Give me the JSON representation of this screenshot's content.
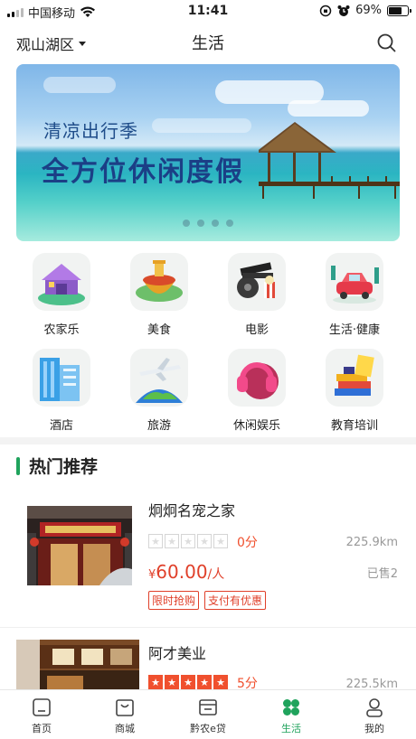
{
  "status_bar": {
    "carrier": "中国移动",
    "time": "11:41",
    "battery": "69%",
    "battery_level": 0.69
  },
  "nav": {
    "location": "观山湖区",
    "title": "生活"
  },
  "banner": {
    "subtitle": "清凉出行季",
    "headline": "全方位休闲度假",
    "slide_count": 4
  },
  "categories": [
    {
      "label": "农家乐",
      "icon": "farmhouse-icon"
    },
    {
      "label": "美食",
      "icon": "hotpot-icon"
    },
    {
      "label": "电影",
      "icon": "movie-icon"
    },
    {
      "label": "生活·健康",
      "icon": "car-wash-icon"
    },
    {
      "label": "酒店",
      "icon": "hotel-icon"
    },
    {
      "label": "旅游",
      "icon": "airplane-icon"
    },
    {
      "label": "休闲娱乐",
      "icon": "headphones-icon"
    },
    {
      "label": "教育培训",
      "icon": "books-icon"
    }
  ],
  "hot": {
    "title": "热门推荐",
    "items": [
      {
        "name": "炯炯名宠之家",
        "rating": 0,
        "score": "0分",
        "distance": "225.9km",
        "price_symbol": "¥",
        "price": "60.00",
        "price_unit": "/人",
        "sold": "已售2",
        "tags": [
          "限时抢购",
          "支付有优惠"
        ]
      },
      {
        "name": "阿才美业",
        "rating": 5,
        "score": "5分",
        "distance": "225.5km"
      }
    ]
  },
  "tabs": [
    {
      "label": "首页",
      "icon": "home-icon",
      "active": false
    },
    {
      "label": "商城",
      "icon": "shopping-bag-icon",
      "active": false
    },
    {
      "label": "黔农e贷",
      "icon": "wallet-icon",
      "active": false
    },
    {
      "label": "生活",
      "icon": "clover-icon",
      "active": true
    },
    {
      "label": "我的",
      "icon": "profile-icon",
      "active": false
    }
  ],
  "colors": {
    "accent": "#1fa35c",
    "price": "#e0402a",
    "star": "#f0502e"
  }
}
